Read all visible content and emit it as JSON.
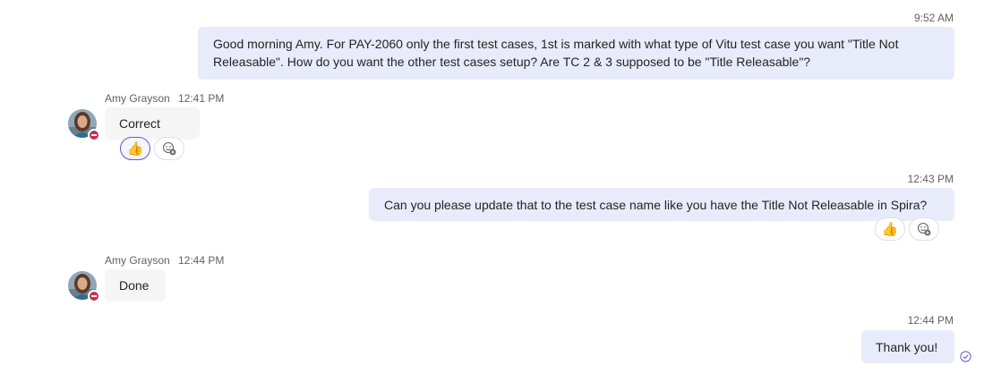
{
  "messages": [
    {
      "time": "9:52 AM",
      "text": "Good morning Amy. For PAY-2060 only the first test cases, 1st is marked with what type of Vitu test case you want \"Title Not Releasable\".  How do you want the other test cases setup? Are TC 2 & 3 supposed to be \"Title Releasable\"?"
    },
    {
      "sender": "Amy Grayson",
      "time": "12:41 PM",
      "text": "Correct"
    },
    {
      "time": "12:43 PM",
      "text": "Can you please update that to the test case name like you have the Title Not Releasable in Spira?"
    },
    {
      "sender": "Amy Grayson",
      "time": "12:44 PM",
      "text": "Done"
    },
    {
      "time": "12:44 PM",
      "text": "Thank you!"
    }
  ],
  "colors": {
    "outgoing_bubble": "#e8ebfa",
    "incoming_bubble": "#f5f5f5",
    "presence_busy": "#c4314b",
    "accent": "#5b5fc7"
  },
  "icons": {
    "reaction_like": "thumbs-up-icon",
    "add_reaction": "add-reaction-icon",
    "seen": "seen-check-icon",
    "presence": "presence-busy-icon"
  }
}
